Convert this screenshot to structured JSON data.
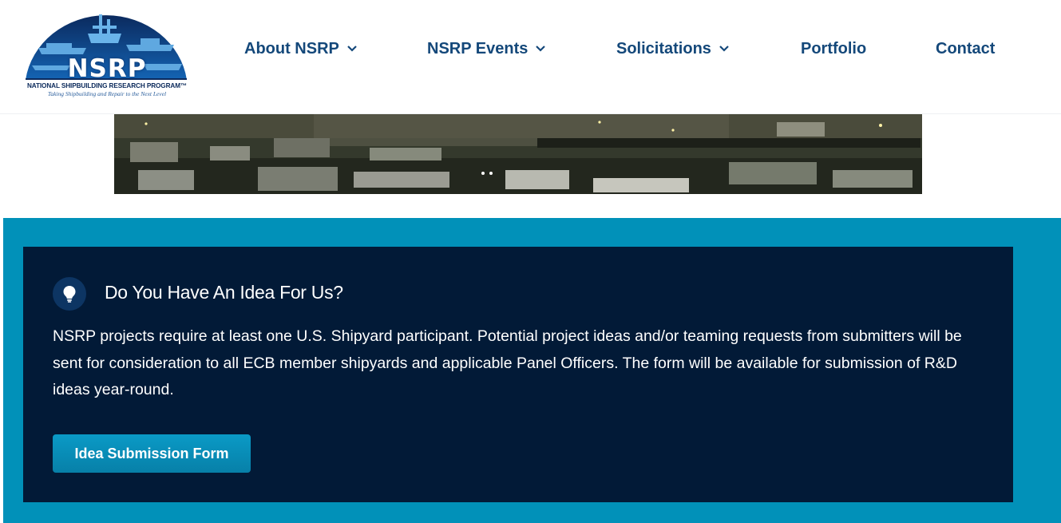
{
  "header": {
    "logo": {
      "mark": "NSRP",
      "name": "NATIONAL SHIPBUILDING RESEARCH PROGRAM™",
      "tagline": "Taking Shipbuilding and Repair to the Next Level"
    },
    "nav": [
      {
        "label": "About NSRP",
        "has_dropdown": true
      },
      {
        "label": "NSRP Events",
        "has_dropdown": true
      },
      {
        "label": "Solicitations",
        "has_dropdown": true
      },
      {
        "label": "Portfolio",
        "has_dropdown": false
      },
      {
        "label": "Contact",
        "has_dropdown": false
      }
    ]
  },
  "idea_section": {
    "icon": "lightbulb-icon",
    "title": "Do You Have An Idea For Us?",
    "body": "NSRP projects require at least one U.S. Shipyard participant. Potential project ideas and/or teaming requests from submitters will be sent for consideration to all ECB member shipyards and applicable Panel Officers. The form will be available for submission of R&D ideas year-round.",
    "button_label": "Idea Submission Form"
  },
  "colors": {
    "nav_text": "#14487a",
    "band": "#0191b9",
    "card": "#021a37",
    "button": "#0a9ac6"
  }
}
